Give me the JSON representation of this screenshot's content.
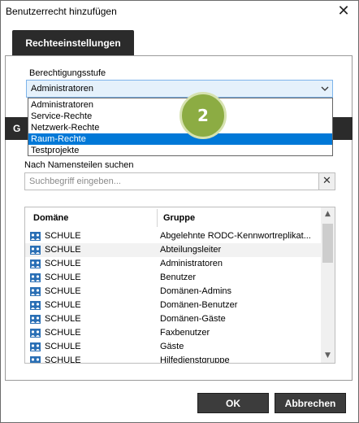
{
  "window": {
    "title": "Benutzerrecht hinzufügen",
    "close_glyph": "✕"
  },
  "tabs": {
    "active_label": "Rechteeinstellungen",
    "second_label": "G"
  },
  "permission": {
    "label": "Berechtigungsstufe",
    "selected": "Administratoren",
    "options": [
      "Administratoren",
      "Service-Rechte",
      "Netzwerk-Rechte",
      "Raum-Rechte",
      "Testprojekte"
    ],
    "highlighted_index": 3
  },
  "badge": {
    "text": "2",
    "color": "#8cac43"
  },
  "search": {
    "label": "Nach Namensteilen suchen",
    "placeholder": "Suchbegriff eingeben...",
    "clear_glyph": "✕"
  },
  "grid": {
    "columns": [
      "Domäne",
      "Gruppe"
    ],
    "rows": [
      {
        "domain": "SCHULE",
        "group": "Abgelehnte RODC-Kennwortreplikat..."
      },
      {
        "domain": "SCHULE",
        "group": "Abteilungsleiter"
      },
      {
        "domain": "SCHULE",
        "group": "Administratoren"
      },
      {
        "domain": "SCHULE",
        "group": "Benutzer"
      },
      {
        "domain": "SCHULE",
        "group": "Domänen-Admins"
      },
      {
        "domain": "SCHULE",
        "group": "Domänen-Benutzer"
      },
      {
        "domain": "SCHULE",
        "group": "Domänen-Gäste"
      },
      {
        "domain": "SCHULE",
        "group": "Faxbenutzer"
      },
      {
        "domain": "SCHULE",
        "group": "Gäste"
      },
      {
        "domain": "SCHULE",
        "group": "Hilfedienstgruppe"
      }
    ],
    "scroll_up_glyph": "▲",
    "scroll_down_glyph": "▼"
  },
  "buttons": {
    "ok": "OK",
    "cancel": "Abbrechen"
  },
  "colors": {
    "accent": "#0078d7",
    "dark": "#2b2b2b",
    "icon_blue": "#2a6fb5"
  }
}
